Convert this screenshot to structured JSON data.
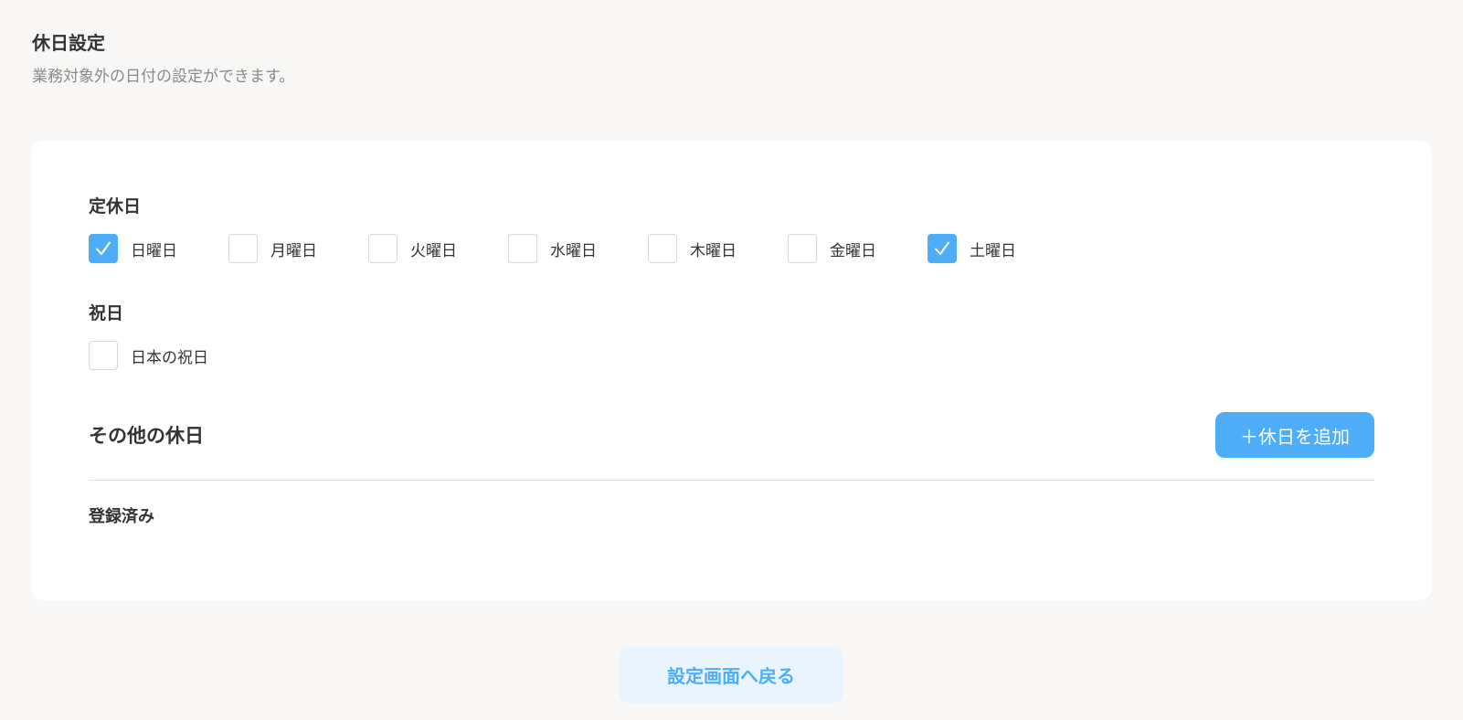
{
  "header": {
    "title": "休日設定",
    "subtitle": "業務対象外の日付の設定ができます。"
  },
  "regular_holidays": {
    "label": "定休日",
    "days": [
      {
        "label": "日曜日",
        "checked": true
      },
      {
        "label": "月曜日",
        "checked": false
      },
      {
        "label": "火曜日",
        "checked": false
      },
      {
        "label": "水曜日",
        "checked": false
      },
      {
        "label": "木曜日",
        "checked": false
      },
      {
        "label": "金曜日",
        "checked": false
      },
      {
        "label": "土曜日",
        "checked": true
      }
    ]
  },
  "public_holidays": {
    "label": "祝日",
    "options": [
      {
        "label": "日本の祝日",
        "checked": false
      }
    ]
  },
  "other_holidays": {
    "title": "その他の休日",
    "add_button_label": "＋休日を追加",
    "registered_label": "登録済み"
  },
  "footer": {
    "back_button_label": "設定画面へ戻る"
  },
  "colors": {
    "accent": "#4eadf8",
    "accent_light": "#eaf4fe",
    "background": "#f8f7f5",
    "card": "#ffffff"
  },
  "icons": {
    "checked": "check-icon"
  }
}
